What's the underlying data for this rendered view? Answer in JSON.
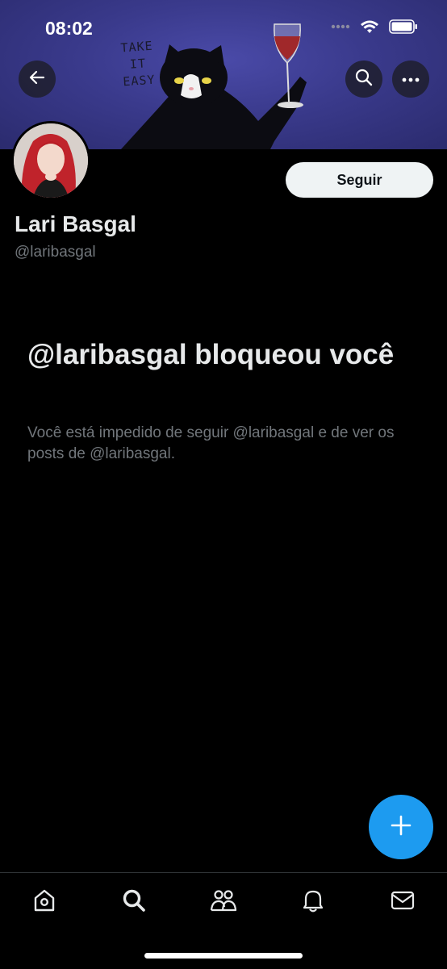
{
  "status_bar": {
    "time": "08:02"
  },
  "banner": {
    "text_line1": "TAKE",
    "text_line2": "IT",
    "text_line3": "EASY"
  },
  "profile": {
    "name": "Lari Basgal",
    "handle": "@laribasgal",
    "follow_label": "Seguir"
  },
  "blocked": {
    "title": "@laribasgal bloqueou você",
    "description": "Você está impedido de seguir @laribasgal e de ver os posts de @laribasgal."
  },
  "icons": {
    "back": "arrow-left-icon",
    "search": "search-icon",
    "more": "more-icon",
    "compose": "plus-icon",
    "nav": [
      "home-icon",
      "search-icon",
      "communities-icon",
      "notifications-icon",
      "messages-icon"
    ]
  },
  "colors": {
    "accent": "#1d9bf0",
    "background": "#000000",
    "text_secondary": "#71767b"
  }
}
